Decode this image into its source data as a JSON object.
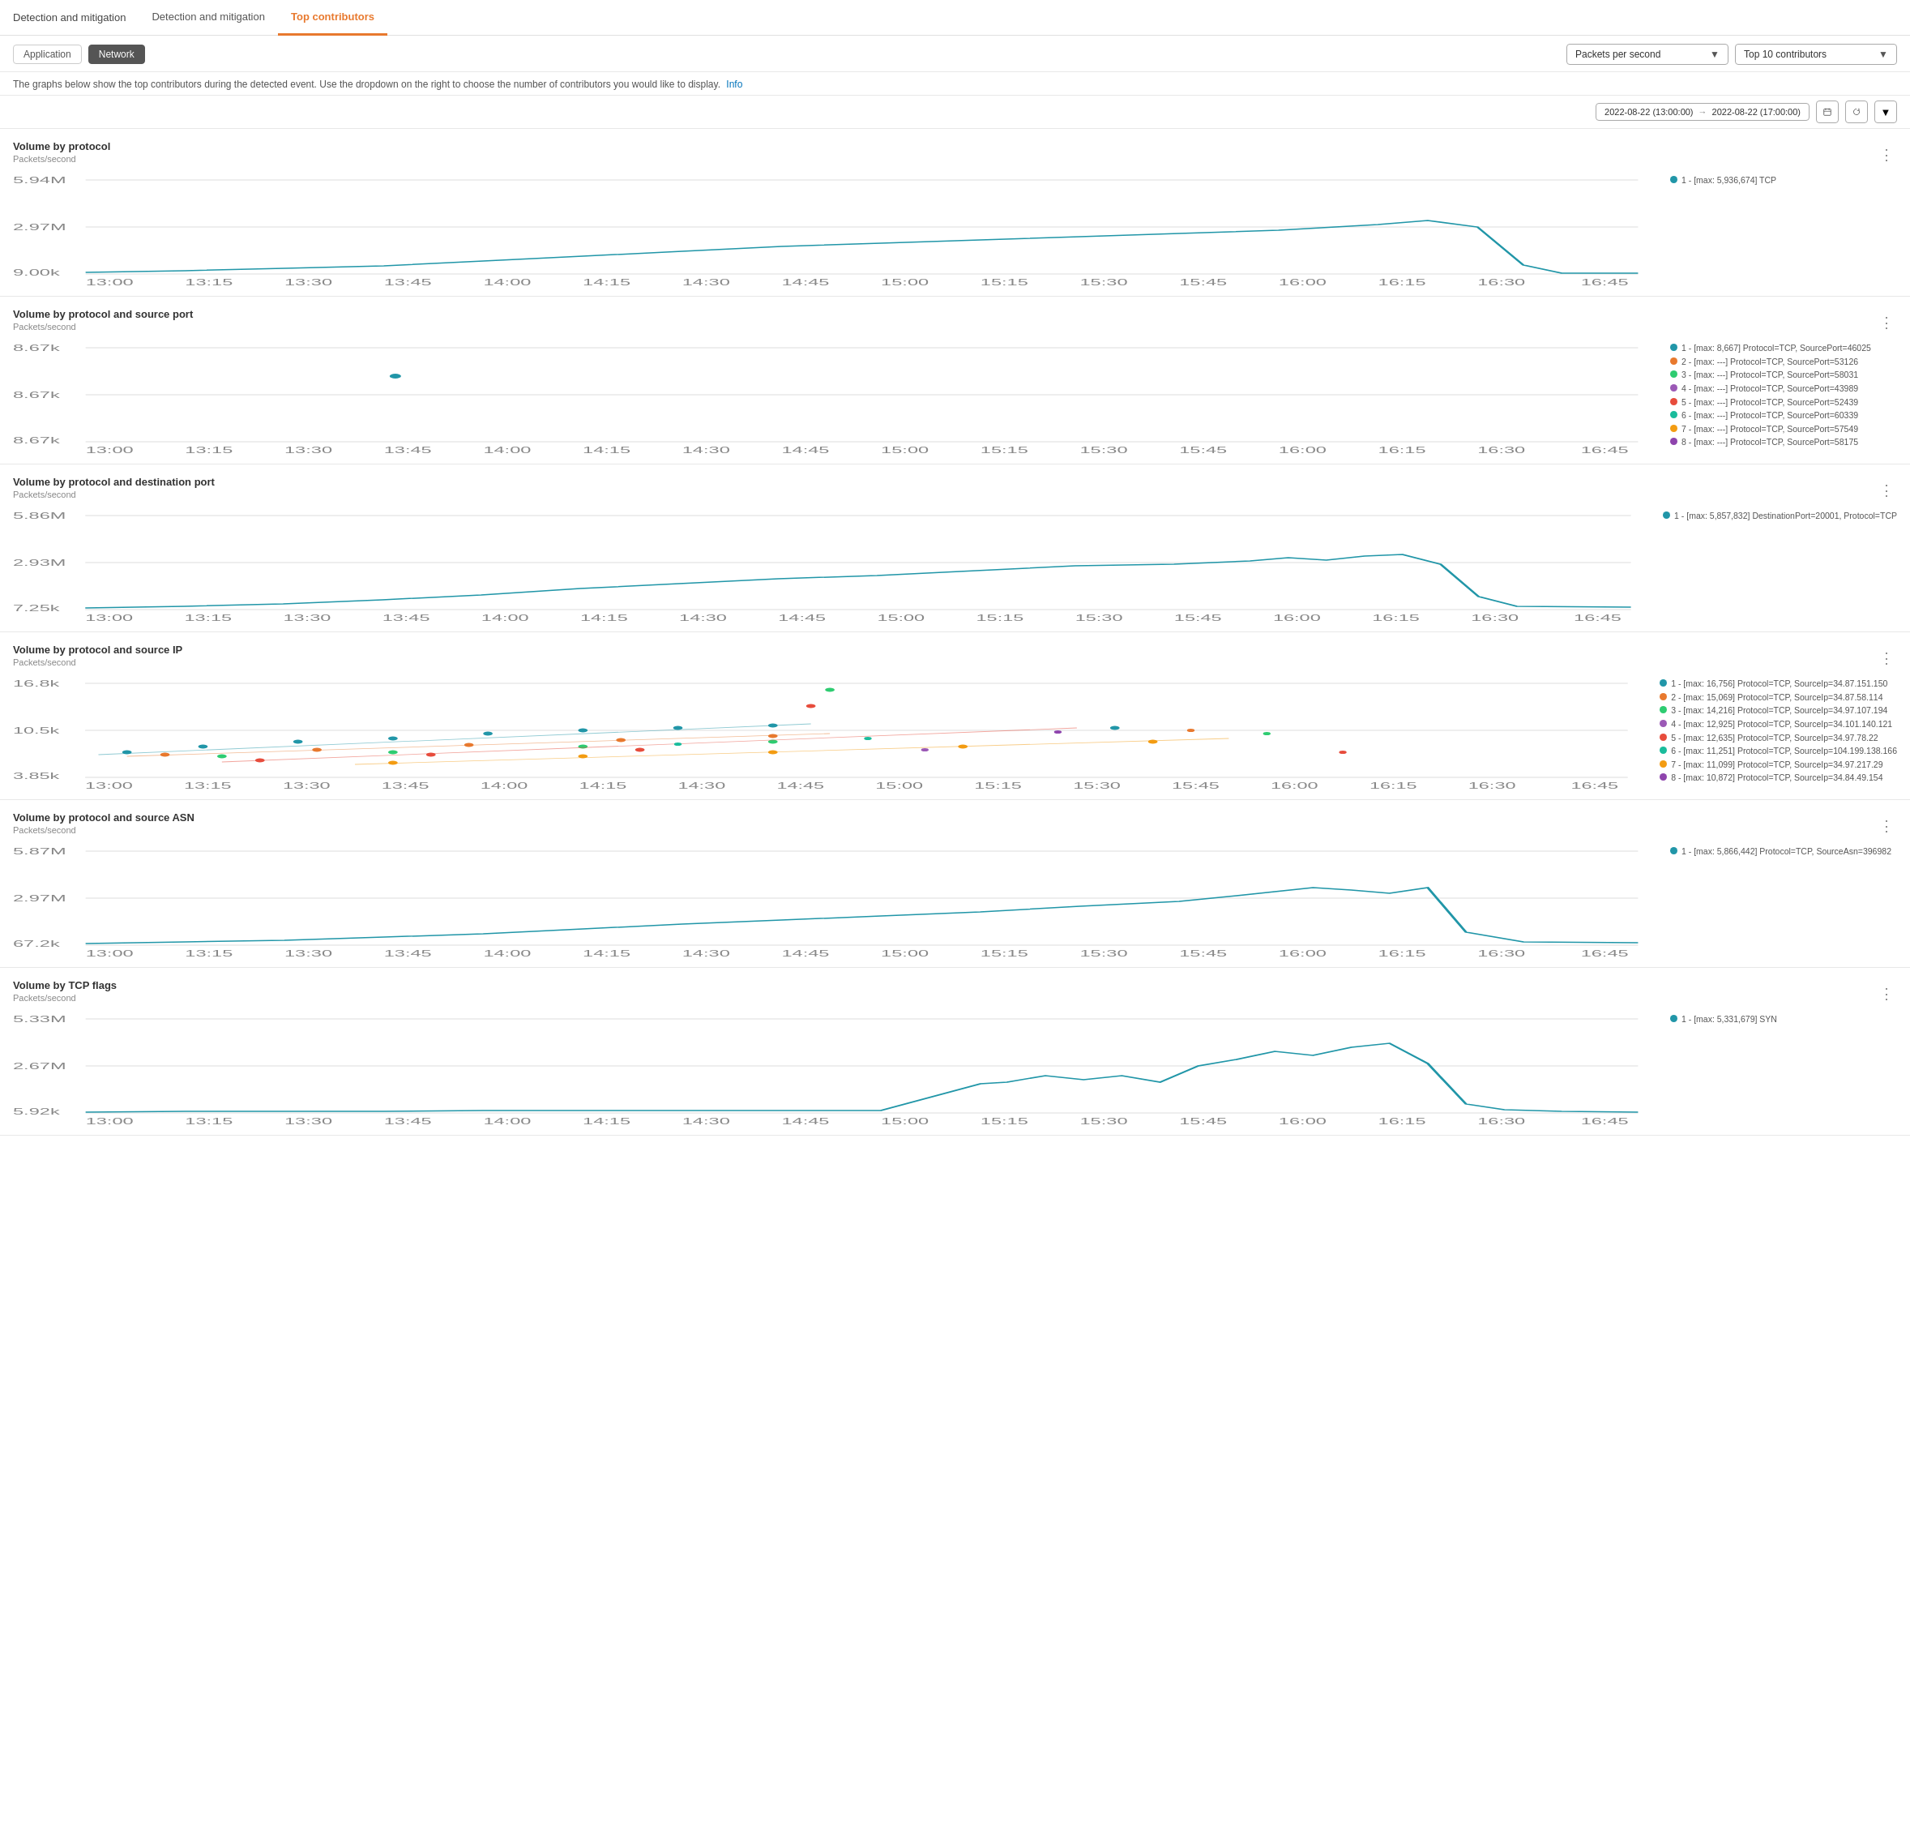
{
  "topNav": {
    "title": "Detection and mitigation",
    "tabs": [
      {
        "label": "Detection and mitigation",
        "active": false
      },
      {
        "label": "Top contributors",
        "active": true
      }
    ]
  },
  "subTabs": [
    {
      "label": "Application",
      "active": false
    },
    {
      "label": "Network",
      "active": true
    }
  ],
  "headerDesc": "The graphs below show the top contributors during the detected event. Use the dropdown on the right to choose the number of contributors you would like to display.",
  "infoLink": "Info",
  "controls": {
    "metric": "Packets per second",
    "topN": "Top 10 contributors"
  },
  "dateRange": {
    "start": "2022-08-22 (13:00:00)",
    "arrow": "→",
    "end": "2022-08-22 (17:00:00)"
  },
  "charts": [
    {
      "id": "volume-by-protocol",
      "title": "Volume by protocol",
      "yLabel": "Packets/second",
      "yMax": "5.94M",
      "yMid": "2.97M",
      "yMin": "9.00k",
      "legend": [
        {
          "color": "#2196a8",
          "label": "1 - [max: 5,936,674] TCP"
        }
      ],
      "type": "single-line",
      "xLabels": [
        "13:00",
        "13:15",
        "13:30",
        "13:45",
        "14:00",
        "14:15",
        "14:30",
        "14:45",
        "15:00",
        "15:15",
        "15:30",
        "15:45",
        "16:00",
        "16:15",
        "16:30",
        "16:45"
      ]
    },
    {
      "id": "volume-by-protocol-source-port",
      "title": "Volume by protocol and source port",
      "yLabel": "Packets/second",
      "yMax": "8.67k",
      "yMid": "8.67k",
      "yMin": "8.67k",
      "legend": [
        {
          "color": "#2196a8",
          "label": "1 - [max: 8,667] Protocol=TCP, SourcePort=46025"
        },
        {
          "color": "#e8792e",
          "label": "2 - [max: ---] Protocol=TCP, SourcePort=53126"
        },
        {
          "color": "#2ecc71",
          "label": "3 - [max: ---] Protocol=TCP, SourcePort=58031"
        },
        {
          "color": "#9b59b6",
          "label": "4 - [max: ---] Protocol=TCP, SourcePort=43989"
        },
        {
          "color": "#e74c3c",
          "label": "5 - [max: ---] Protocol=TCP, SourcePort=52439"
        },
        {
          "color": "#1abc9c",
          "label": "6 - [max: ---] Protocol=TCP, SourcePort=60339"
        },
        {
          "color": "#f39c12",
          "label": "7 - [max: ---] Protocol=TCP, SourcePort=57549"
        },
        {
          "color": "#8e44ad",
          "label": "8 - [max: ---] Protocol=TCP, SourcePort=58175"
        }
      ],
      "type": "scatter",
      "xLabels": [
        "13:00",
        "13:15",
        "13:30",
        "13:45",
        "14:00",
        "14:15",
        "14:30",
        "14:45",
        "15:00",
        "15:15",
        "15:30",
        "15:45",
        "16:00",
        "16:15",
        "16:30",
        "16:45"
      ]
    },
    {
      "id": "volume-by-protocol-dest-port",
      "title": "Volume by protocol and destination port",
      "yLabel": "Packets/second",
      "yMax": "5.86M",
      "yMid": "2.93M",
      "yMin": "7.25k",
      "legend": [
        {
          "color": "#2196a8",
          "label": "1 - [max: 5,857,832] DestinationPort=20001, Protocol=TCP"
        }
      ],
      "type": "single-line",
      "xLabels": [
        "13:00",
        "13:15",
        "13:30",
        "13:45",
        "14:00",
        "14:15",
        "14:30",
        "14:45",
        "15:00",
        "15:15",
        "15:30",
        "15:45",
        "16:00",
        "16:15",
        "16:30",
        "16:45"
      ]
    },
    {
      "id": "volume-by-protocol-source-ip",
      "title": "Volume by protocol and source IP",
      "yLabel": "Packets/second",
      "yMax": "16.8k",
      "yMid": "10.5k",
      "yMin": "3.85k",
      "legend": [
        {
          "color": "#2196a8",
          "label": "1 - [max: 16,756] Protocol=TCP, SourceIp=34.87.151.150"
        },
        {
          "color": "#e8792e",
          "label": "2 - [max: 15,069] Protocol=TCP, SourceIp=34.87.58.114"
        },
        {
          "color": "#2ecc71",
          "label": "3 - [max: 14,216] Protocol=TCP, SourceIp=34.97.107.194"
        },
        {
          "color": "#9b59b6",
          "label": "4 - [max: 12,925] Protocol=TCP, SourceIp=34.101.140.121"
        },
        {
          "color": "#e74c3c",
          "label": "5 - [max: 12,635] Protocol=TCP, SourceIp=34.97.78.22"
        },
        {
          "color": "#1abc9c",
          "label": "6 - [max: 11,251] Protocol=TCP, SourceIp=104.199.138.166"
        },
        {
          "color": "#f39c12",
          "label": "7 - [max: 11,099] Protocol=TCP, SourceIp=34.97.217.29"
        },
        {
          "color": "#8e44ad",
          "label": "8 - [max: 10,872] Protocol=TCP, SourceIp=34.84.49.154"
        }
      ],
      "type": "multi-scatter",
      "xLabels": [
        "13:00",
        "13:15",
        "13:30",
        "13:45",
        "14:00",
        "14:15",
        "14:30",
        "14:45",
        "15:00",
        "15:15",
        "15:30",
        "15:45",
        "16:00",
        "16:15",
        "16:30",
        "16:45"
      ]
    },
    {
      "id": "volume-by-protocol-source-asn",
      "title": "Volume by protocol and source ASN",
      "yLabel": "Packets/second",
      "yMax": "5.87M",
      "yMid": "2.97M",
      "yMin": "67.2k",
      "legend": [
        {
          "color": "#2196a8",
          "label": "1 - [max: 5,866,442] Protocol=TCP, SourceAsn=396982"
        }
      ],
      "type": "single-line",
      "xLabels": [
        "13:00",
        "13:15",
        "13:30",
        "13:45",
        "14:00",
        "14:15",
        "14:30",
        "14:45",
        "15:00",
        "15:15",
        "15:30",
        "15:45",
        "16:00",
        "16:15",
        "16:30",
        "16:45"
      ]
    },
    {
      "id": "volume-by-tcp-flags",
      "title": "Volume by TCP flags",
      "yLabel": "Packets/second",
      "yMax": "5.33M",
      "yMid": "2.67M",
      "yMin": "5.92k",
      "legend": [
        {
          "color": "#2196a8",
          "label": "1 - [max: 5,331,679] SYN"
        }
      ],
      "type": "tcp-flags",
      "xLabels": [
        "13:00",
        "13:15",
        "13:30",
        "13:45",
        "14:00",
        "14:15",
        "14:30",
        "14:45",
        "15:00",
        "15:15",
        "15:30",
        "15:45",
        "16:00",
        "16:15",
        "16:30",
        "16:45"
      ]
    }
  ]
}
